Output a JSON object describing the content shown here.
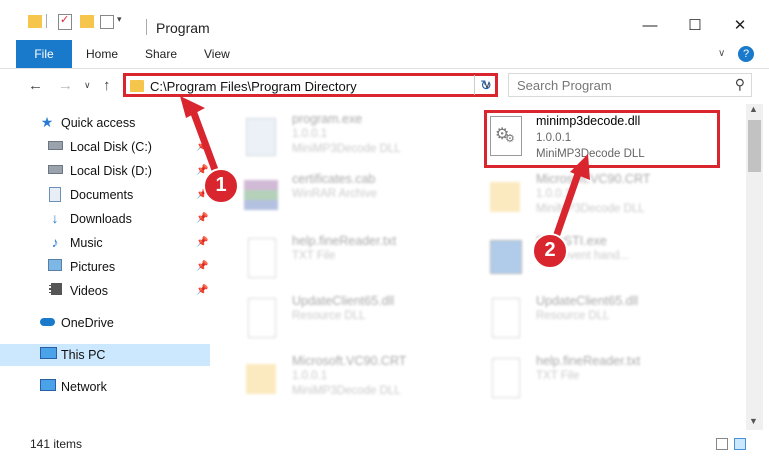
{
  "window": {
    "title": "Program",
    "minimize": "—",
    "maximize": "☐",
    "close": "✕"
  },
  "ribbon": {
    "tabs": [
      "File",
      "Home",
      "Share",
      "View"
    ]
  },
  "address": {
    "path": "C:\\Program Files\\Program Directory"
  },
  "search": {
    "placeholder": "Search Program"
  },
  "sidebar": {
    "items": [
      {
        "label": "Quick access",
        "icon": "star-icon"
      },
      {
        "label": "Local Disk (C:)",
        "icon": "drive-icon"
      },
      {
        "label": "Local Disk (D:)",
        "icon": "drive-icon"
      },
      {
        "label": "Documents",
        "icon": "documents-icon"
      },
      {
        "label": "Downloads",
        "icon": "downloads-icon"
      },
      {
        "label": "Music",
        "icon": "music-icon"
      },
      {
        "label": "Pictures",
        "icon": "pictures-icon"
      },
      {
        "label": "Videos",
        "icon": "videos-icon"
      },
      {
        "label": "OneDrive",
        "icon": "cloud-icon"
      },
      {
        "label": "This PC",
        "icon": "computer-icon"
      },
      {
        "label": "Network",
        "icon": "network-icon"
      }
    ]
  },
  "files": [
    {
      "name": "program.exe",
      "line2": "1.0.0.1",
      "line3": "MiniMP3Decode DLL"
    },
    {
      "name": "minimp3decode.dll",
      "line2": "1.0.0.1",
      "line3": "MiniMP3Decode DLL"
    },
    {
      "name": "certificates.cab",
      "line2": "WinRAR Archive"
    },
    {
      "name": "Microsoft.VC90.CRT",
      "line2": "1.0.0.1",
      "line3": "MiniMP3Decode DLL"
    },
    {
      "name": "help.fineReader.txt",
      "line2": "TXT File"
    },
    {
      "name": "EasySTI.exe",
      "line2": "Web event hand..."
    },
    {
      "name": "UpdateClient65.dll",
      "line2": "Resource DLL"
    },
    {
      "name": "UpdateClient65.dll",
      "line2": "Resource DLL"
    },
    {
      "name": "Microsoft.VC90.CRT",
      "line2": "1.0.0.1",
      "line3": "MiniMP3Decode DLL"
    },
    {
      "name": "help.fineReader.txt",
      "line2": "TXT File"
    }
  ],
  "status": {
    "count": "141 items"
  },
  "annotations": {
    "step1": "1",
    "step2": "2"
  },
  "colors": {
    "accent": "#1979ca",
    "highlight": "#d9262e",
    "selection": "#cce8ff"
  }
}
